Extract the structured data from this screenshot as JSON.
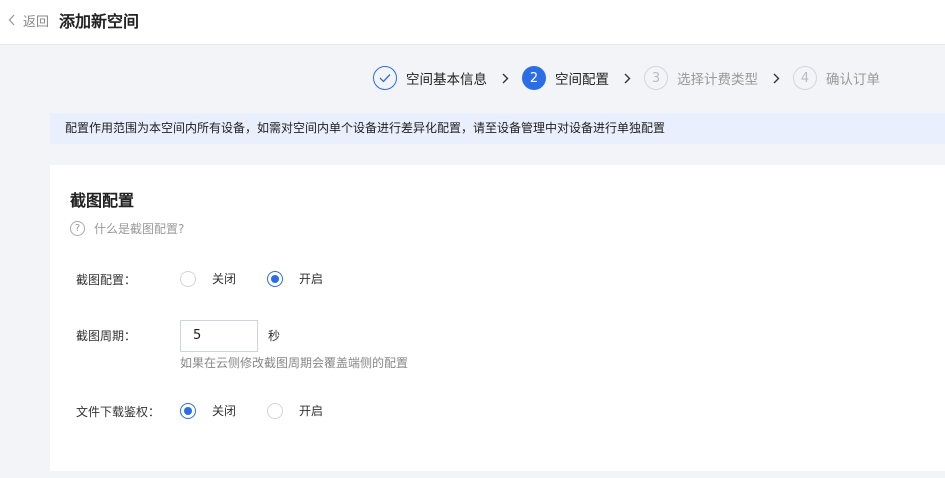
{
  "header": {
    "back_label": "返回",
    "title": "添加新空间"
  },
  "steps": [
    {
      "number": "1",
      "label": "空间基本信息",
      "status": "done"
    },
    {
      "number": "2",
      "label": "空间配置",
      "status": "active"
    },
    {
      "number": "3",
      "label": "选择计费类型",
      "status": "pending"
    },
    {
      "number": "4",
      "label": "确认订单",
      "status": "pending"
    }
  ],
  "notice": "配置作用范围为本空间内所有设备，如需对空间内单个设备进行差异化配置，请至设备管理中对设备进行单独配置",
  "card": {
    "title": "截图配置",
    "help_text": "什么是截图配置?",
    "screenshot": {
      "label": "截图配置：",
      "option_off": "关闭",
      "option_on": "开启",
      "selected": "on"
    },
    "period": {
      "label": "截图周期：",
      "value": "5",
      "unit": "秒",
      "hint": "如果在云侧修改截图周期会覆盖端侧的配置"
    },
    "download_auth": {
      "label": "文件下载鉴权：",
      "option_off": "关闭",
      "option_on": "开启",
      "selected": "off"
    }
  },
  "colors": {
    "accent": "#2b6de5",
    "notice_bg": "#e9effd",
    "page_bg": "#f3f4f7"
  }
}
